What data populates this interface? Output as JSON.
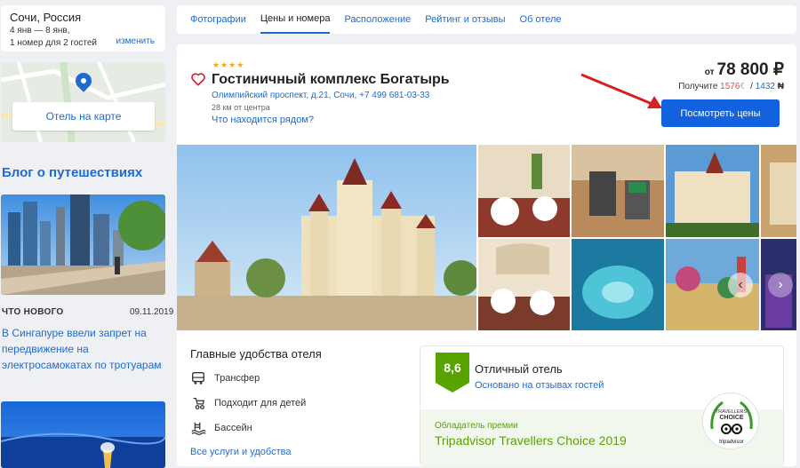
{
  "search": {
    "city": "Сочи, Россия",
    "dates": "4 янв — 8 янв,",
    "guests": "1 номер для 2 гостей",
    "change_label": "изменить"
  },
  "map": {
    "button_label": "Отель на карте"
  },
  "blog": {
    "title": "Блог о путешествиях",
    "news": {
      "category": "ЧТО НОВОГО",
      "date": "09.11.2019",
      "headline": "В Сингапуре ввели запрет на передвижение на электросамокатах по тротуарам"
    }
  },
  "tabs": [
    {
      "label": "Фотографии",
      "active": false
    },
    {
      "label": "Цены и номера",
      "active": true
    },
    {
      "label": "Расположение",
      "active": false
    },
    {
      "label": "Рейтинг и отзывы",
      "active": false
    },
    {
      "label": "Об отеле",
      "active": false
    }
  ],
  "hotel": {
    "stars": "★★★★",
    "name": "Гостиничный комплекс Богатырь",
    "address": "Олимпийский проспект, д.21, Сочи, +7 499 681-03-33",
    "distance": "28 км от центра",
    "nearby_label": "Что находится рядом?"
  },
  "price": {
    "prefix": "от",
    "amount": "78 800 ₽",
    "bonus_prefix": "Получите",
    "bonus_red": "1576",
    "bonus_sep": " / ",
    "bonus_blue": "1432",
    "cta_label": "Посмотреть цены"
  },
  "amenities": {
    "title": "Главные удобства отеля",
    "items": [
      {
        "icon": "transfer-icon",
        "label": "Трансфер"
      },
      {
        "icon": "kids-icon",
        "label": "Подходит для детей"
      },
      {
        "icon": "pool-icon",
        "label": "Бассейн"
      }
    ],
    "all_link": "Все услуги и удобства"
  },
  "rating": {
    "score": "8,6",
    "label": "Отличный отель",
    "sub": "Основано на отзывах гостей",
    "award_label": "Обладатель премии",
    "award_name": "Tripadvisor Travellers Choice 2019",
    "badge_text_1": "TRAVELLERS'",
    "badge_text_2": "CHOICE",
    "badge_text_3": "tripadvisor"
  },
  "colors": {
    "accent": "#1f6ad1",
    "cta": "#1262e0",
    "rating_green": "#58a300",
    "bonus_red": "#e34b4b",
    "arrow_red": "#d81e1e",
    "stars": "#f5a623"
  }
}
